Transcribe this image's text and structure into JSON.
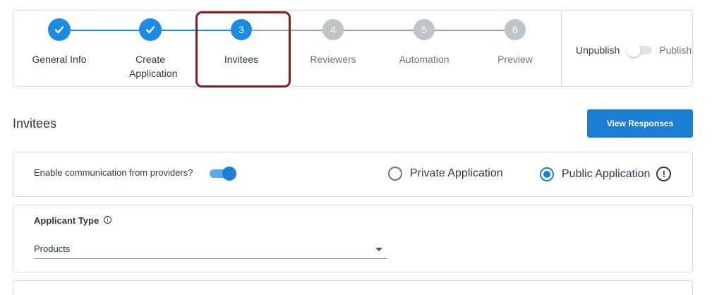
{
  "stepper": {
    "steps": [
      {
        "number": "1",
        "label": "General Info",
        "state": "done"
      },
      {
        "number": "2",
        "label": "Create Application",
        "state": "done"
      },
      {
        "number": "3",
        "label": "Invitees",
        "state": "active"
      },
      {
        "number": "4",
        "label": "Reviewers",
        "state": "todo"
      },
      {
        "number": "5",
        "label": "Automation",
        "state": "todo"
      },
      {
        "number": "6",
        "label": "Preview",
        "state": "todo"
      }
    ],
    "check_icon": "check-icon",
    "highlight_color": "#8b1a1f"
  },
  "publish": {
    "unpublish_label": "Unpublish",
    "publish_label": "Publish",
    "state": "unpublished"
  },
  "section": {
    "title": "Invitees",
    "view_responses_label": "View Responses"
  },
  "communication": {
    "label": "Enable communication from providers?",
    "enabled": true,
    "options": [
      {
        "label": "Private Application",
        "checked": false
      },
      {
        "label": "Public Application",
        "checked": true
      }
    ],
    "alert_icon": "alert-circle-icon",
    "alert_glyph": "!"
  },
  "applicant_type": {
    "title": "Applicant Type",
    "info_glyph": "i",
    "selected": "Products",
    "caret_icon": "caret-down-icon"
  },
  "colors": {
    "accent": "#1c8be4",
    "button": "#1c7fd4",
    "inactive_step": "#bfc4c8",
    "text": "#2d3b45"
  }
}
